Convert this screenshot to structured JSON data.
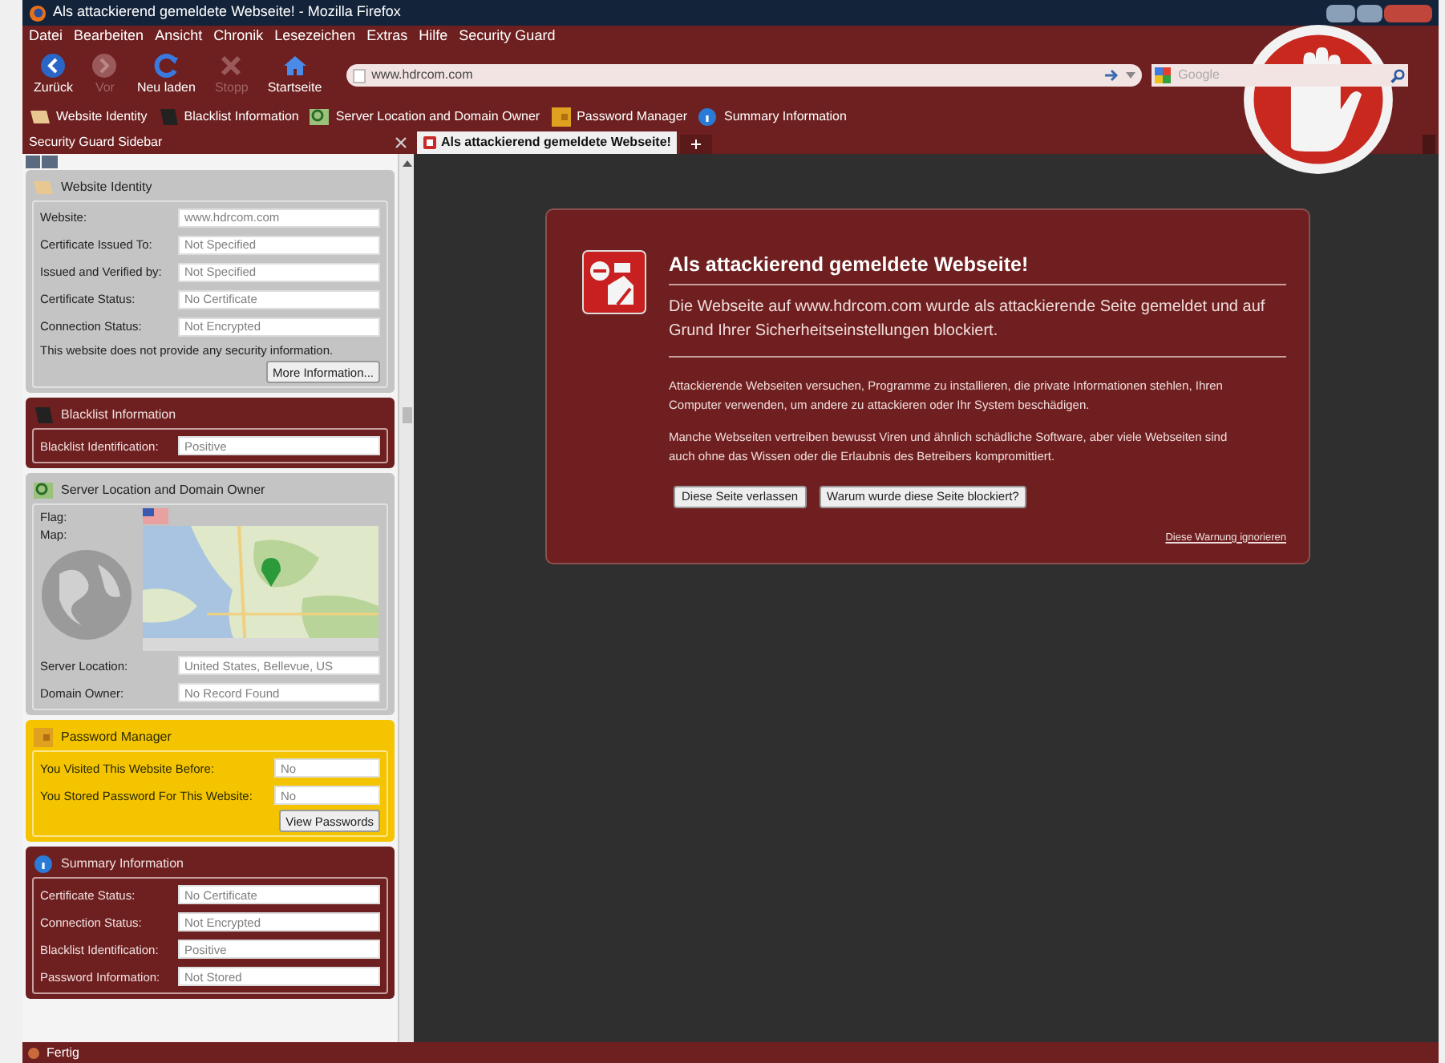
{
  "window": {
    "title": "Als attackierend gemeldete Webseite! - Mozilla Firefox"
  },
  "menu": [
    "Datei",
    "Bearbeiten",
    "Ansicht",
    "Chronik",
    "Lesezeichen",
    "Extras",
    "Hilfe",
    "Security Guard"
  ],
  "toolbar": [
    {
      "label": "Zurück",
      "disabled": false
    },
    {
      "label": "Vor",
      "disabled": true
    },
    {
      "label": "Neu laden",
      "disabled": false
    },
    {
      "label": "Stopp",
      "disabled": true
    },
    {
      "label": "Startseite",
      "disabled": false
    }
  ],
  "address": {
    "value": "www.hdrcom.com"
  },
  "search": {
    "placeholder": "Google"
  },
  "bookmarks": [
    "Website Identity",
    "Blacklist Information",
    "Server Location and Domain Owner",
    "Password Manager",
    "Summary Information"
  ],
  "sidebar": {
    "title": "Security Guard Sidebar",
    "panels": [
      {
        "title": "Website Identity",
        "kind": "neutral",
        "fields": [
          {
            "label": "Website:",
            "value": "www.hdrcom.com"
          },
          {
            "label": "Certificate Issued To:",
            "value": "Not Specified"
          },
          {
            "label": "Issued and Verified by:",
            "value": "Not Specified"
          },
          {
            "label": "Certificate Status:",
            "value": "No Certificate"
          },
          {
            "label": "Connection Status:",
            "value": "Not Encrypted"
          }
        ],
        "note": "This website does not provide any security information.",
        "button": "More Information..."
      },
      {
        "title": "Blacklist Information",
        "kind": "danger",
        "fields": [
          {
            "label": "Blacklist Identification:",
            "value": "Positive"
          }
        ]
      },
      {
        "title": "Server Location and Domain Owner",
        "kind": "neutral",
        "flag_label": "Flag:",
        "map_label": "Map:",
        "fields": [
          {
            "label": "Server Location:",
            "value": "United States, Bellevue, US"
          },
          {
            "label": "Domain Owner:",
            "value": "No Record Found"
          }
        ]
      },
      {
        "title": "Password Manager",
        "kind": "warning",
        "fields": [
          {
            "label": "You Visited This Website Before:",
            "value": "No"
          },
          {
            "label": "You Stored Password For This Website:",
            "value": "No"
          }
        ],
        "button": "View Passwords"
      },
      {
        "title": "Summary Information",
        "kind": "danger",
        "fields": [
          {
            "label": "Certificate Status:",
            "value": "No Certificate"
          },
          {
            "label": "Connection Status:",
            "value": "Not Encrypted"
          },
          {
            "label": "Blacklist Identification:",
            "value": "Positive"
          },
          {
            "label": "Password Information:",
            "value": "Not Stored"
          }
        ]
      }
    ]
  },
  "tabs": [
    {
      "label": "Als attackierend gemeldete Webseite!",
      "selected": true
    }
  ],
  "warning": {
    "title": "Als attackierend gemeldete Webseite!",
    "lead": "Die Webseite auf www.hdrcom.com wurde als attackierende Seite gemeldet und auf Grund Ihrer Sicherheitseinstellungen blockiert.",
    "paragraphs": [
      "Attackierende Webseiten versuchen, Programme zu installieren, die private Informationen stehlen, Ihren Computer verwenden, um andere zu attackieren oder Ihr System beschädigen.",
      "Manche Webseiten vertreiben bewusst Viren und ähnlich schädliche Software, aber viele Webseiten sind auch ohne das Wissen oder die Erlaubnis des Betreibers kompromittiert."
    ],
    "buttons": [
      "Diese Seite verlassen",
      "Warum wurde diese Seite blockiert?"
    ],
    "ignore_link": "Diese Warnung ignorieren"
  },
  "status_bar": "Fertig"
}
